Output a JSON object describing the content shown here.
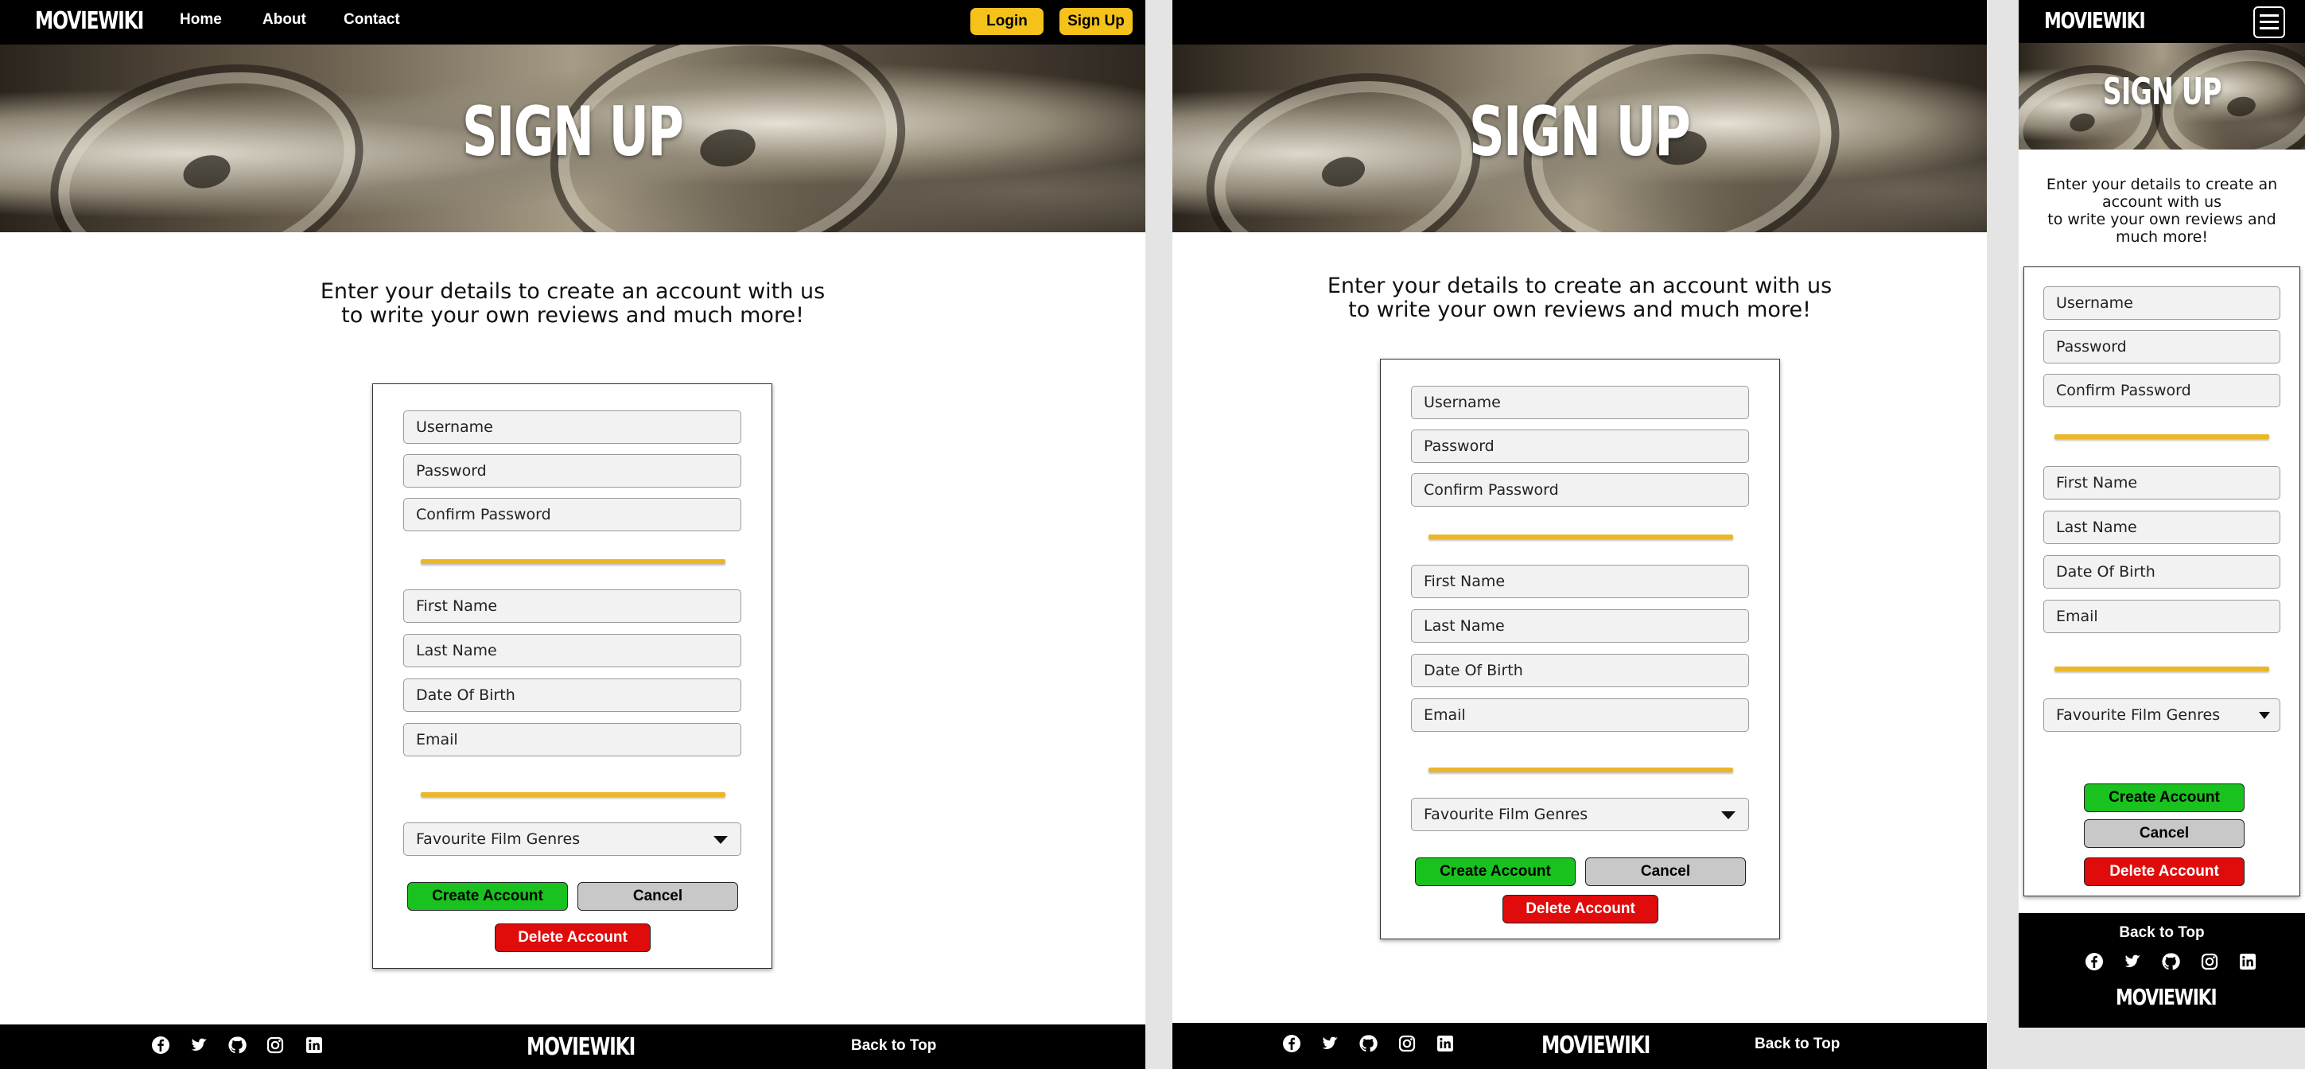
{
  "brand": "MOVIEWIKI",
  "nav": {
    "home": "Home",
    "about": "About",
    "contact": "Contact",
    "login": "Login",
    "signup": "Sign Up"
  },
  "hero": {
    "title": "SIGN UP"
  },
  "intro": {
    "line1": "Enter your details to create an account with us",
    "line2": "to write your own reviews and much more!"
  },
  "intro_mobile": {
    "line1": "Enter your details to create an",
    "line2": "account with us",
    "line3": "to write your own reviews and",
    "line4": "much more!"
  },
  "form": {
    "username": "Username",
    "password": "Password",
    "confirm_password": "Confirm Password",
    "first_name": "First Name",
    "last_name": "Last Name",
    "date_of_birth": "Date Of Birth",
    "email": "Email",
    "genres": "Favourite Film Genres",
    "create": "Create Account",
    "cancel": "Cancel",
    "delete": "Delete Account"
  },
  "footer": {
    "back_to_top": "Back to Top",
    "socials": [
      "facebook-icon",
      "twitter-icon",
      "github-icon",
      "instagram-icon",
      "linkedin-icon"
    ]
  },
  "colors": {
    "accent": "#f4c21a",
    "divider": "#eab62a",
    "create": "#19c21f",
    "cancel": "#c8c8c8",
    "delete": "#e00b0b",
    "bar": "#000000"
  }
}
